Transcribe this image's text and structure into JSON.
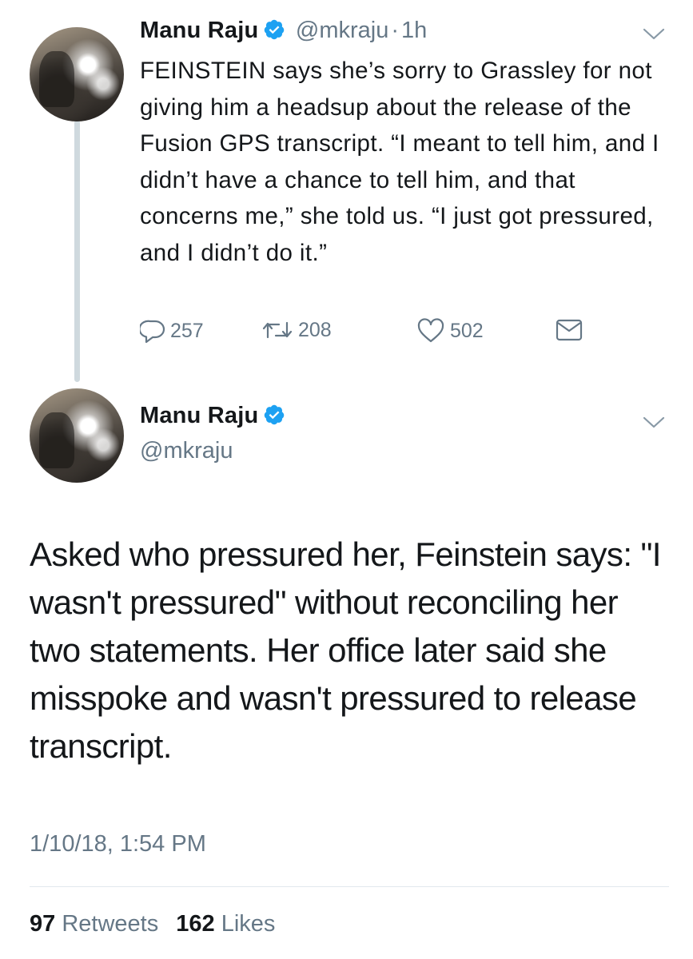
{
  "parent_tweet": {
    "author_name": "Manu Raju",
    "handle": "@mkraju",
    "separator": "·",
    "time": "1h",
    "text": "FEINSTEIN says she’s sorry to Grassley for not giving him a headsup about the release of the Fusion GPS transcript. “I meant to tell him, and I didn’t have a chance to tell him, and that concerns me,” she told us. “I just got pressured, and I didn’t do it.”",
    "actions": {
      "replies": "257",
      "retweets": "208",
      "likes": "502"
    }
  },
  "main_tweet": {
    "author_name": "Manu Raju",
    "handle": "@mkraju",
    "text": "Asked who pressured her, Feinstein says: \"I wasn't pressured\" without reconciling her two statements. Her office later said she misspoke and wasn't pressured to release transcript.",
    "timestamp": "1/10/18, 1:54 PM",
    "stats": {
      "retweets_count": "97",
      "retweets_label": "Retweets",
      "likes_count": "162",
      "likes_label": "Likes"
    }
  },
  "icons": {
    "verified": "verified-badge-icon",
    "menu": "chevron-down-icon",
    "reply": "reply-icon",
    "retweet": "retweet-icon",
    "like": "heart-icon",
    "dm": "envelope-icon"
  },
  "colors": {
    "verified_blue": "#1da1f2",
    "secondary_text": "#657786",
    "primary_text": "#14171a",
    "thread_line": "#cfd9de"
  }
}
